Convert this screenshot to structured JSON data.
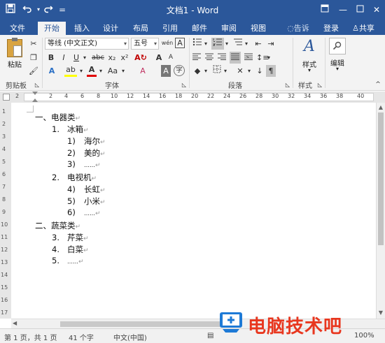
{
  "titlebar": {
    "title": "文档1 - Word",
    "save_icon": "save-icon",
    "undo_icon": "undo-icon",
    "redo_icon": "redo-icon",
    "customize_glyph": "="
  },
  "tabs": [
    {
      "label": "文件"
    },
    {
      "label": "开始"
    },
    {
      "label": "插入"
    },
    {
      "label": "设计"
    },
    {
      "label": "布局"
    },
    {
      "label": "引用"
    },
    {
      "label": "邮件"
    },
    {
      "label": "审阅"
    },
    {
      "label": "视图"
    }
  ],
  "tell_me": "告诉我...",
  "login_label": "登录",
  "share_label": "共享",
  "ribbon": {
    "clipboard": {
      "label": "剪贴板",
      "paste_label": "粘贴"
    },
    "font": {
      "label": "字体",
      "font_name": "等线 (中文正文)",
      "font_size": "五号",
      "wen": "wén",
      "bold": "B",
      "italic": "I",
      "underline": "U",
      "strike": "abc",
      "sub": "x₂",
      "sup": "x²",
      "effects": "A",
      "highlight": "ab",
      "color": "A",
      "size_case": "Aa",
      "grow": "A",
      "shrink": "A",
      "clear": "A",
      "char_border": "A",
      "phonetic": "字"
    },
    "paragraph": {
      "label": "段落"
    },
    "styles": {
      "label": "样式",
      "button": "样式"
    },
    "editing": {
      "button": "编辑"
    }
  },
  "ruler": {
    "ticks": [
      "2",
      "2",
      "4",
      "6",
      "8",
      "10",
      "12",
      "14",
      "16",
      "18",
      "20",
      "22",
      "24",
      "26",
      "28",
      "30",
      "32",
      "34",
      "36",
      "38",
      "40"
    ],
    "vticks": [
      "1",
      "2",
      "3",
      "4",
      "5",
      "6",
      "7",
      "8",
      "9",
      "10",
      "11",
      "12",
      "13",
      "14",
      "15",
      "16",
      "17"
    ]
  },
  "document": {
    "lines": [
      {
        "num": "一、",
        "text": "电器类"
      },
      {
        "num": "1.",
        "text": "冰箱"
      },
      {
        "num": "1)",
        "text": "海尔"
      },
      {
        "num": "2)",
        "text": "美的"
      },
      {
        "num": "3)",
        "text": "……"
      },
      {
        "num": "2.",
        "text": "电视机"
      },
      {
        "num": "4)",
        "text": "长虹"
      },
      {
        "num": "5)",
        "text": "小米"
      },
      {
        "num": "6)",
        "text": "……"
      },
      {
        "num": "二、",
        "text": "蔬菜类"
      },
      {
        "num": "3.",
        "text": "芹菜"
      },
      {
        "num": "4.",
        "text": "白菜"
      },
      {
        "num": "5.",
        "text": "……"
      }
    ],
    "para_mark": "↵"
  },
  "status": {
    "page": "第 1 页，共 1 页",
    "words": "41 个字",
    "language": "中文(中国)",
    "zoom": "100%"
  },
  "watermark": {
    "text": "电脑技术吧"
  },
  "colors": {
    "accent": "#2b579a",
    "watermark": "#e8371f"
  }
}
